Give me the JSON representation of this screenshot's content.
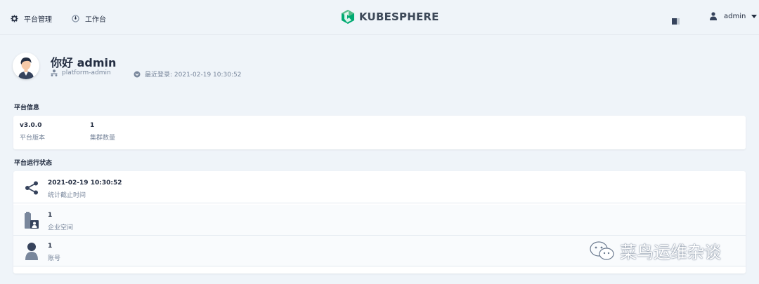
{
  "topbar": {
    "platform_label": "平台管理",
    "workbench_label": "工作台",
    "logo_text": "KUBESPHERE",
    "user_name": "admin"
  },
  "profile": {
    "greeting": "你好 admin",
    "role": "platform-admin",
    "last_login": "最近登录: 2021-02-19 10:30:52"
  },
  "platform_info": {
    "title": "平台信息",
    "items": [
      {
        "value": "v3.0.0",
        "label": "平台版本"
      },
      {
        "value": "1",
        "label": "集群数量"
      }
    ]
  },
  "platform_status": {
    "title": "平台运行状态",
    "rows": [
      {
        "value": "2021-02-19 10:30:52",
        "label": "统计截止时间",
        "icon": "share-nodes-icon"
      },
      {
        "value": "1",
        "label": "企业空间",
        "icon": "workspace-icon"
      },
      {
        "value": "1",
        "label": "账号",
        "icon": "user-icon"
      }
    ]
  },
  "watermark": "菜鸟运维杂谈",
  "colors": {
    "background": "#eff4f9",
    "text": "#242e42",
    "muted": "#79879c",
    "brand": "#00aa72"
  }
}
